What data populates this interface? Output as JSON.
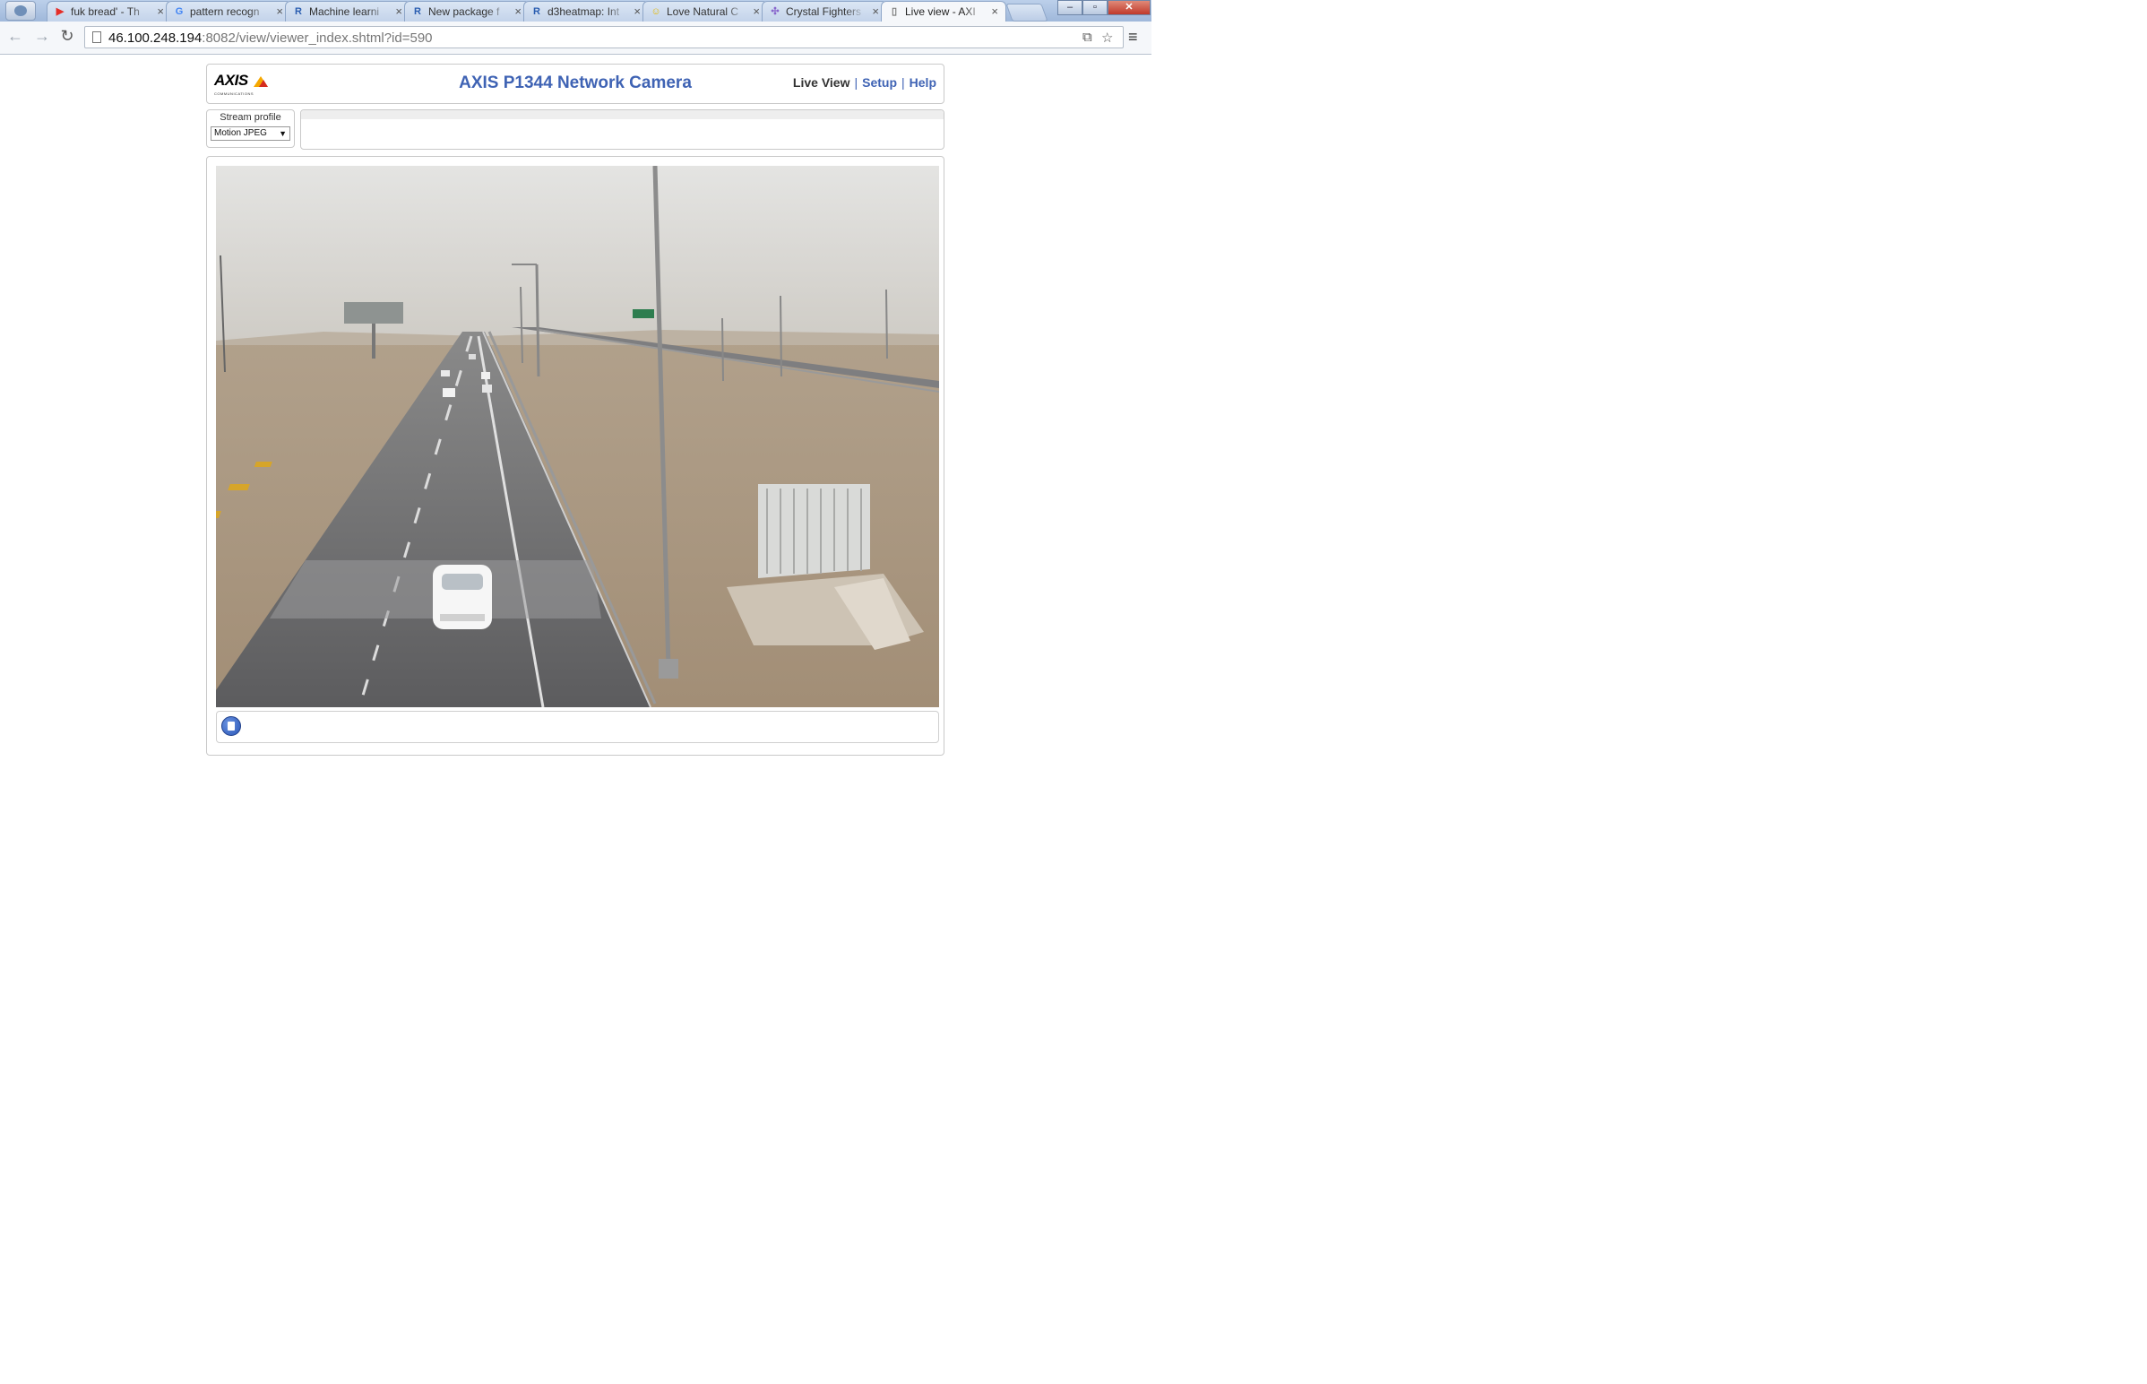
{
  "browser": {
    "tabs": [
      {
        "title": "fuk bread' - Th",
        "favicon": "youtube-icon",
        "color": "#e52d27"
      },
      {
        "title": "pattern recogn",
        "favicon": "google-icon",
        "color": "#4285f4"
      },
      {
        "title": "Machine learni",
        "favicon": "r-icon",
        "color": "#2a5db0"
      },
      {
        "title": "New package f",
        "favicon": "r-icon",
        "color": "#2a5db0"
      },
      {
        "title": "d3heatmap: Int",
        "favicon": "r-icon",
        "color": "#2a5db0"
      },
      {
        "title": "Love Natural C",
        "favicon": "smiley-icon",
        "color": "#e6b800"
      },
      {
        "title": "Crystal Fighters",
        "favicon": "puzzle-icon",
        "color": "#8866cc"
      },
      {
        "title": "Live view - AXI",
        "favicon": "page-icon",
        "color": "#777777"
      }
    ],
    "active_tab": 7,
    "url_host": "46.100.248.194",
    "url_rest": ":8082/view/viewer_index.shtml?id=590"
  },
  "header": {
    "logo_text": "AXIS",
    "logo_sub": "COMMUNICATIONS",
    "title": "AXIS P1344 Network Camera",
    "nav_live": "Live View",
    "nav_setup": "Setup",
    "nav_help": "Help",
    "nav_separator": "|"
  },
  "stream": {
    "label": "Stream profile",
    "value": "Motion JPEG"
  },
  "colors": {
    "accent": "#3f63b4",
    "logo_yellow": "#f5a800",
    "logo_red": "#d52b1e"
  }
}
